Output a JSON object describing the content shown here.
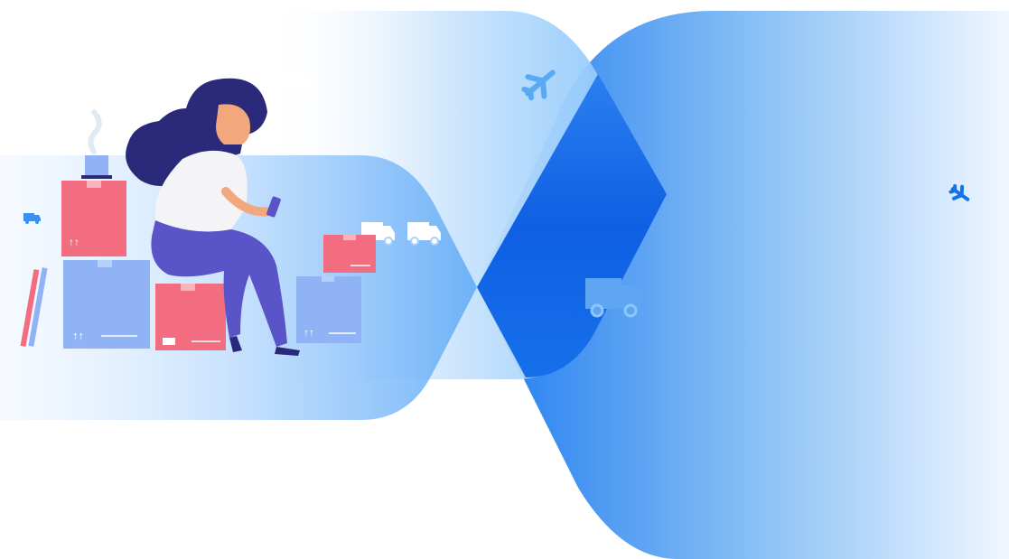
{
  "scene": {
    "background_color": "#ffffff",
    "icons": [
      "plane-icon",
      "delivery-truck-icon",
      "cardboard-box-icon",
      "smartphone-icon",
      "lamp-icon",
      "coffee-cup-icon"
    ],
    "colors": {
      "band_blue": "#1f7cf0",
      "band_light_blue": "#8cc8ff",
      "overlap_blue": "#1466e8",
      "box_red": "#f26d7f",
      "box_blue": "#8fb3f5",
      "hair_navy": "#2b2a7a",
      "pants_indigo": "#5a54c9",
      "skin": "#f2a77d",
      "shirt": "#f4f4f6"
    }
  }
}
